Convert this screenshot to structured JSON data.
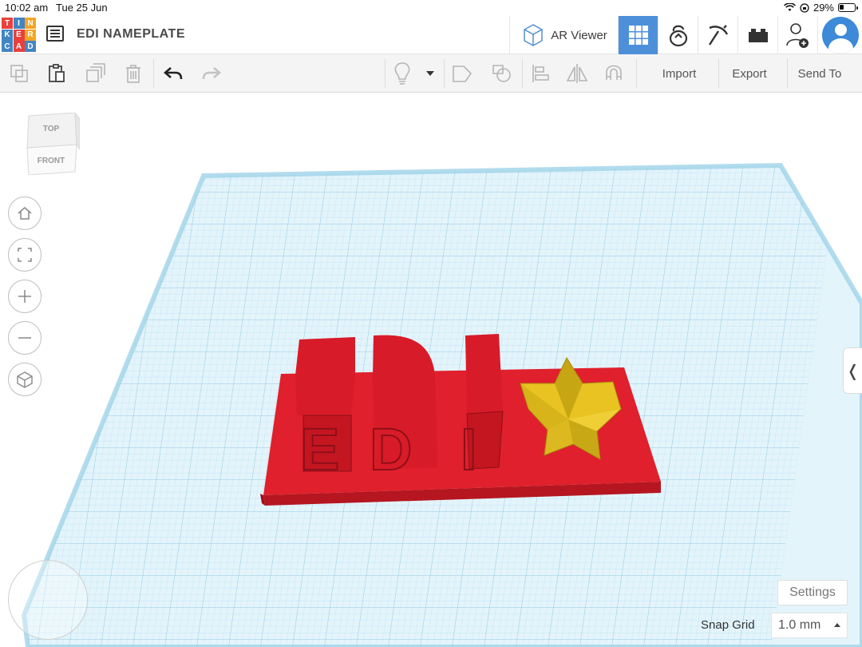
{
  "status_bar": {
    "time": "10:02 am",
    "date": "Tue 25 Jun",
    "battery_percent": "29%",
    "battery_level": 0.29
  },
  "header": {
    "logo_letters": [
      "T",
      "I",
      "N",
      "K",
      "E",
      "R",
      "C",
      "A",
      "D"
    ],
    "logo_colors": [
      "#e8413c",
      "#4285c3",
      "#f5a623",
      "#4285c3",
      "#e8413c",
      "#f5a623",
      "#4285c3",
      "#e8413c",
      "#4285c3"
    ],
    "doc_title": "EDI NAMEPLATE",
    "ar_viewer_label": "AR Viewer",
    "accent_color": "#4d90d9"
  },
  "toolbar": {
    "import_label": "Import",
    "export_label": "Export",
    "send_to_label": "Send To"
  },
  "viewcube": {
    "top_label": "TOP",
    "front_label": "FRONT"
  },
  "scene": {
    "nameplate_text": "EDI",
    "base_color": "#e0202c",
    "star_color": "#e8c322",
    "grid_color": "#9fd3e8"
  },
  "settings_label": "Settings",
  "snap_grid": {
    "label": "Snap Grid",
    "value": "1.0 mm"
  }
}
